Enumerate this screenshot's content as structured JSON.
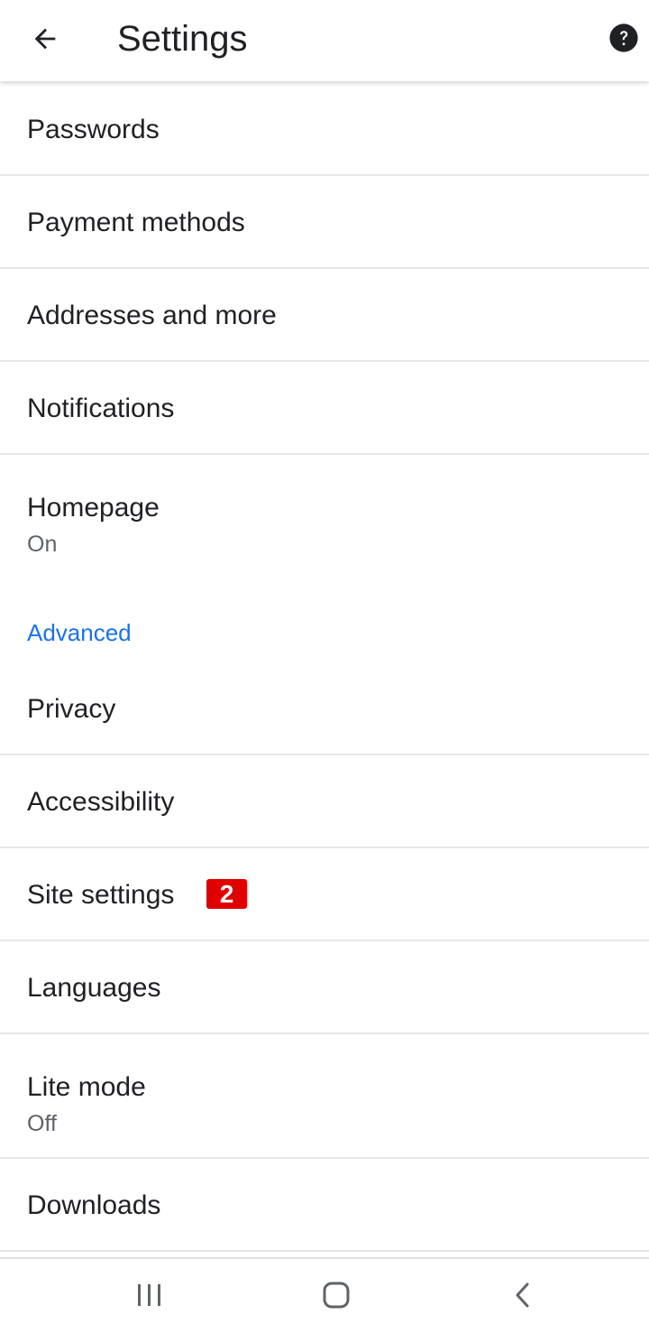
{
  "app_bar": {
    "title": "Settings",
    "back_icon": "arrow-left-icon",
    "help_icon": "help-circle-icon"
  },
  "items_top": [
    {
      "label": "Passwords"
    },
    {
      "label": "Payment methods"
    },
    {
      "label": "Addresses and more"
    },
    {
      "label": "Notifications"
    },
    {
      "label": "Homepage",
      "sub": "On"
    }
  ],
  "advanced_header": "Advanced",
  "items_advanced": [
    {
      "label": "Privacy"
    },
    {
      "label": "Accessibility"
    },
    {
      "label": "Site settings",
      "badge": "2"
    },
    {
      "label": "Languages"
    },
    {
      "label": "Lite mode",
      "sub": "Off"
    },
    {
      "label": "Downloads"
    }
  ],
  "colors": {
    "accent": "#1a73e8",
    "badge": "#e00000",
    "divider": "#e6e6e6",
    "secondary_text": "#5f6368"
  },
  "nav_bar": {
    "recents_icon": "recent-apps-icon",
    "home_icon": "home-icon",
    "back_icon": "back-icon"
  }
}
